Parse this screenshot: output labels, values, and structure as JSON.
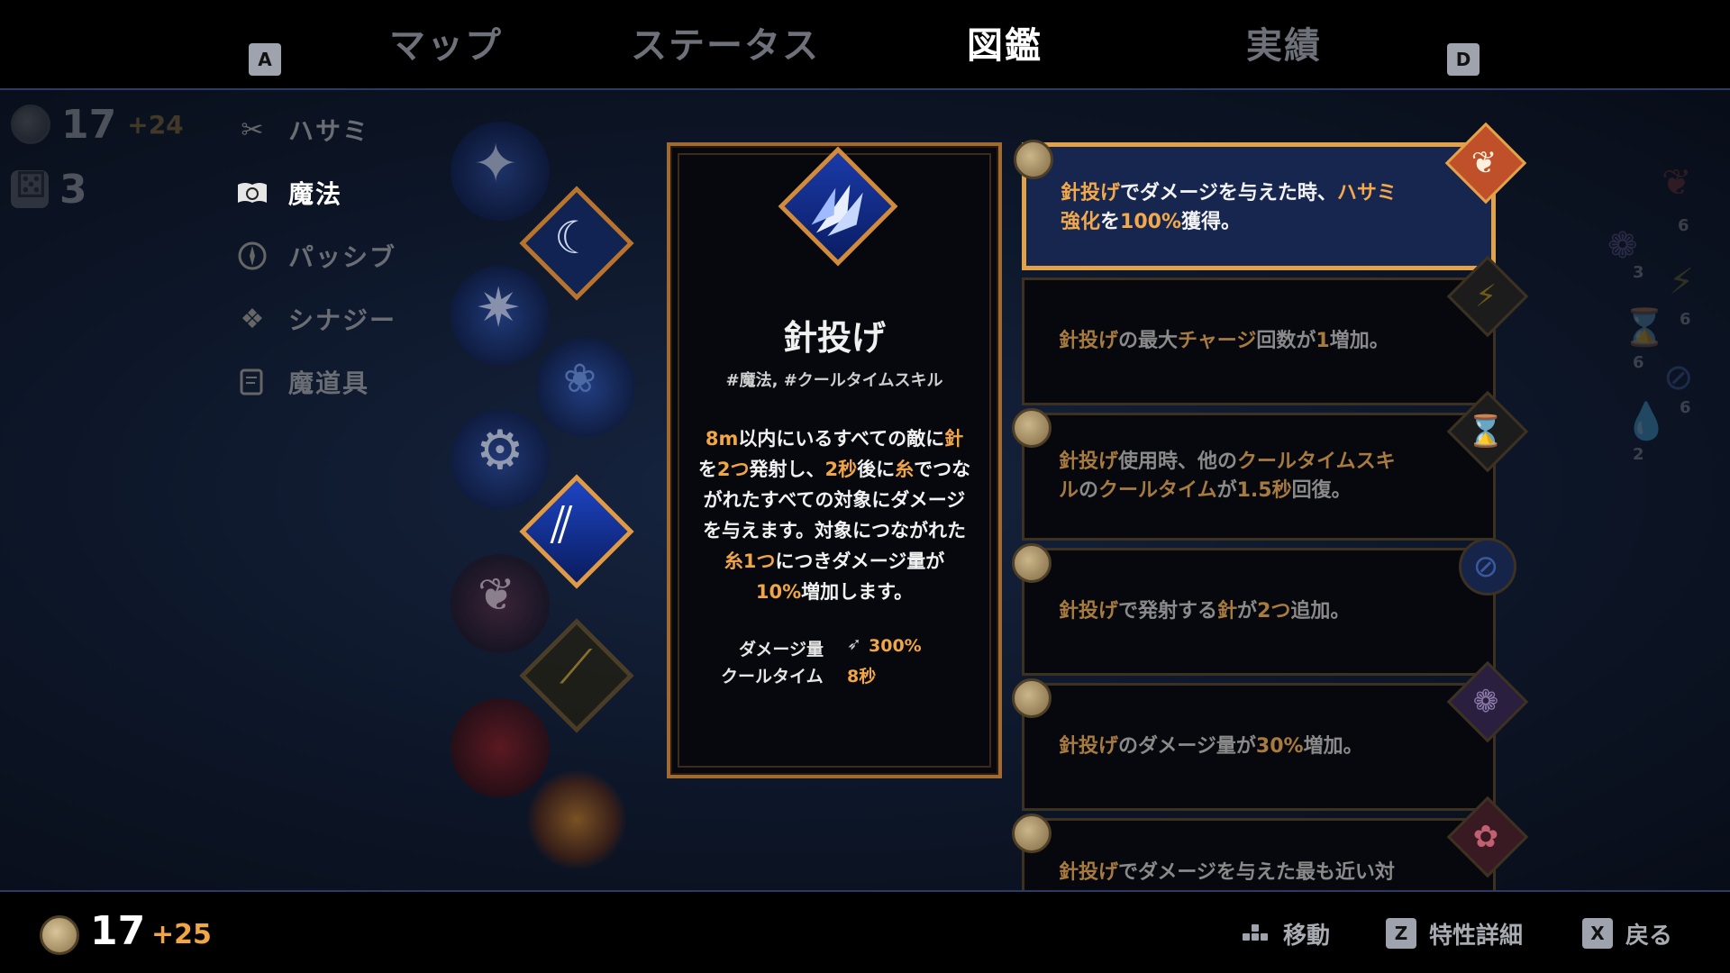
{
  "tabs": {
    "left_key": "A",
    "right_key": "D",
    "items": [
      {
        "label": "マップ"
      },
      {
        "label": "ステータス"
      },
      {
        "label": "図鑑"
      },
      {
        "label": "実績"
      }
    ],
    "active_index": 2
  },
  "resources": {
    "coins": "17",
    "coins_plus": "+24",
    "dice": "3"
  },
  "categories": [
    {
      "label": "ハサミ",
      "icon": "scissors-icon"
    },
    {
      "label": "魔法",
      "icon": "spellbook-icon"
    },
    {
      "label": "パッシブ",
      "icon": "compass-icon"
    },
    {
      "label": "シナジー",
      "icon": "synergy-icon"
    },
    {
      "label": "魔道具",
      "icon": "scroll-icon"
    }
  ],
  "active_category_index": 1,
  "skill_card": {
    "title": "針投げ",
    "tags": "#魔法, #クールタイムスキル",
    "desc_lines": [
      [
        "8m",
        "以内にいるすべての敵に",
        "針"
      ],
      [
        "を",
        "2つ",
        "発射し、",
        "2秒",
        "後に",
        "糸",
        "でつな"
      ],
      [
        "がれたすべての対象にダメージ"
      ],
      [
        "を与えます。対象につながれた"
      ],
      [
        "糸1つ",
        "につきダメージ量が"
      ],
      [
        "10%",
        "増加します。"
      ]
    ],
    "stats": {
      "damage_label": "ダメージ量",
      "damage_value": "300%",
      "cooldown_label": "クールタイム",
      "cooldown_value": "8秒"
    }
  },
  "traits": [
    {
      "text": [
        [
          "針投げ",
          "hl"
        ],
        [
          "でダメージを与えた時、",
          ""
        ],
        [
          "ハサミ",
          "hl"
        ],
        [
          "\n",
          ""
        ],
        [
          "強化",
          "hl"
        ],
        [
          "を",
          ""
        ],
        [
          "100%",
          "hl"
        ],
        [
          "獲得。",
          ""
        ]
      ],
      "badge": "moth-icon",
      "selected": true
    },
    {
      "text": [
        [
          "針投げ",
          "hl"
        ],
        [
          "の最大",
          ""
        ],
        [
          "チャージ",
          "hl"
        ],
        [
          "回数が",
          ""
        ],
        [
          "1",
          "hl"
        ],
        [
          "増加。",
          ""
        ]
      ],
      "badge": "lightning-icon",
      "selected": false
    },
    {
      "text": [
        [
          "針投げ",
          "hl"
        ],
        [
          "使用時、他の",
          ""
        ],
        [
          "クールタイムスキ",
          "hl"
        ],
        [
          "\n",
          ""
        ],
        [
          "ル",
          "hl"
        ],
        [
          "の",
          ""
        ],
        [
          "クールタイム",
          "hl"
        ],
        [
          "が",
          ""
        ],
        [
          "1.5秒",
          "hl"
        ],
        [
          "回復。",
          ""
        ]
      ],
      "badge": "hourglass-icon",
      "selected": false
    },
    {
      "text": [
        [
          "針投げ",
          "hl"
        ],
        [
          "で発射する",
          ""
        ],
        [
          "針",
          "hl"
        ],
        [
          "が",
          ""
        ],
        [
          "2つ",
          "hl"
        ],
        [
          "追加。",
          ""
        ]
      ],
      "badge": "thread-spool-icon",
      "selected": false
    },
    {
      "text": [
        [
          "針投げ",
          "hl"
        ],
        [
          "のダメージ量が",
          ""
        ],
        [
          "30%",
          "hl"
        ],
        [
          "増加。",
          ""
        ]
      ],
      "badge": "flower-bud-icon",
      "selected": false
    },
    {
      "text": [
        [
          "針投げ",
          "hl"
        ],
        [
          "でダメージを与えた最も近い対",
          ""
        ]
      ],
      "badge": "sakura-icon",
      "selected": false
    }
  ],
  "side_numbers": [
    "6",
    "3",
    "6",
    "6",
    "6",
    "2"
  ],
  "footer": {
    "coins": "17",
    "coins_plus": "+25",
    "hints": [
      {
        "key": "",
        "icon": "dpad-icon",
        "label": "移動"
      },
      {
        "key": "Z",
        "icon": "",
        "label": "特性詳細"
      },
      {
        "key": "X",
        "icon": "",
        "label": "戻る"
      }
    ]
  },
  "colors": {
    "accent_orange": "#f0a546",
    "frame_gold": "#c8843b",
    "selected_bg": "#16264f",
    "nav_line": "#2a3b66"
  }
}
